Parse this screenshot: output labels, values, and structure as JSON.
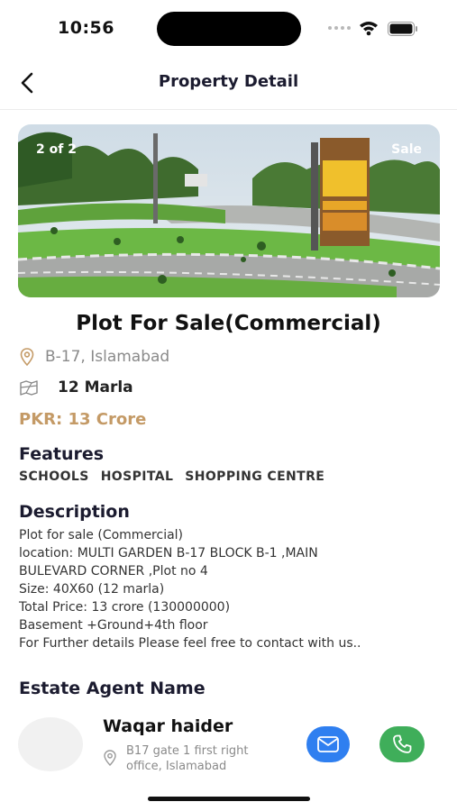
{
  "status_bar": {
    "time": "10:56"
  },
  "header": {
    "title": "Property Detail",
    "back_icon": "chevron-left-icon"
  },
  "gallery": {
    "counter": "2 of 2",
    "badge": "Sale"
  },
  "property": {
    "title": "Plot For Sale(Commercial)",
    "location": "B-17, Islamabad",
    "size": "12 Marla",
    "price": "PKR: 13 Crore",
    "price_color": "#c49a66"
  },
  "features": {
    "title": "Features",
    "items": [
      "SCHOOLS",
      "HOSPITAL",
      "SHOPPING CENTRE"
    ]
  },
  "description": {
    "title": "Description",
    "lines": [
      "Plot for sale (Commercial)",
      "location:  MULTI GARDEN B-17 BLOCK B-1 ,MAIN",
      "BULEVARD CORNER ,Plot no 4",
      "Size:  40X60 (12 marla)",
      "Total Price: 13 crore (130000000)",
      "Basement +Ground+4th floor",
      "For Further details Please feel free to contact with us.."
    ]
  },
  "agent": {
    "section_title": "Estate Agent Name",
    "name": "Waqar haider",
    "address_line1": "B17 gate 1 first right",
    "address_line2": "office, Islamabad",
    "email_color": "#2f7ff0",
    "call_color": "#3fae5a"
  }
}
